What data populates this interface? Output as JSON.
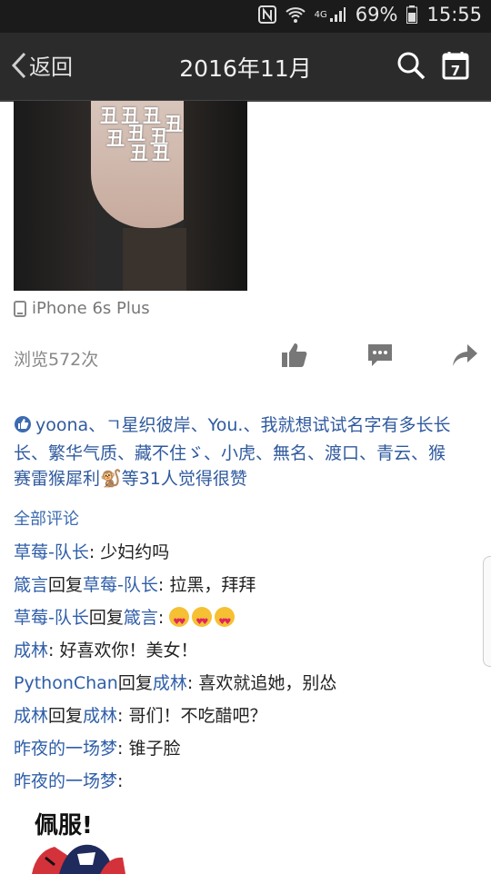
{
  "status_bar": {
    "network": "4G",
    "battery": "69%",
    "time": "15:55"
  },
  "nav": {
    "back_label": "返回",
    "title": "2016年11月"
  },
  "post": {
    "photo_stickers": "丑",
    "device": "iPhone 6s Plus",
    "views": "浏览572次"
  },
  "likes": {
    "text_line1": "yoona、ㄱ星织彼岸、You.、我就想试试名字有多长长",
    "text_line2": "长、繁华气质、藏不住ゞ、小虎、無名、渡口、青云、猴",
    "text_line3": "赛雷猴犀利",
    "monkey_emoji": "🐒",
    "text_line3b": "等31人觉得很赞"
  },
  "comments_header": "全部评论",
  "comments": [
    {
      "user": "草莓-队长",
      "reply_word": "",
      "reply_to": "",
      "text": ": 少妇约吗"
    },
    {
      "user": "箴言",
      "reply_word": "回复",
      "reply_to": "草莓-队长",
      "text": ": 拉黑，拜拜"
    },
    {
      "user": "草莓-队长",
      "reply_word": "回复",
      "reply_to": "箴言",
      "text": ": "
    },
    {
      "user": "成林",
      "reply_word": "",
      "reply_to": "",
      "text": ": 好喜欢你！美女！"
    },
    {
      "user": "PythonChan",
      "reply_word": "回复",
      "reply_to": "成林",
      "text": ": 喜欢就追她，别怂"
    },
    {
      "user": "成林",
      "reply_word": "回复",
      "reply_to": "成林",
      "text": ": 哥们！不吃醋吧？"
    },
    {
      "user": "昨夜的一场梦",
      "reply_word": "",
      "reply_to": "",
      "text": ": 锥子脸"
    },
    {
      "user": "昨夜的一场梦",
      "reply_word": "",
      "reply_to": "",
      "text": ":"
    }
  ],
  "sticker_text": "佩服!",
  "colors": {
    "link": "#2f5ea8",
    "nav_bg": "#2b2b2b",
    "status_bg": "#1b1b1b"
  },
  "icons": [
    "nfc-icon",
    "wifi-icon",
    "signal-icon",
    "battery-icon",
    "back-chevron-icon",
    "search-icon",
    "calendar-icon",
    "phone-icon",
    "thumbs-up-icon",
    "comment-icon",
    "share-icon",
    "like-small-icon"
  ]
}
